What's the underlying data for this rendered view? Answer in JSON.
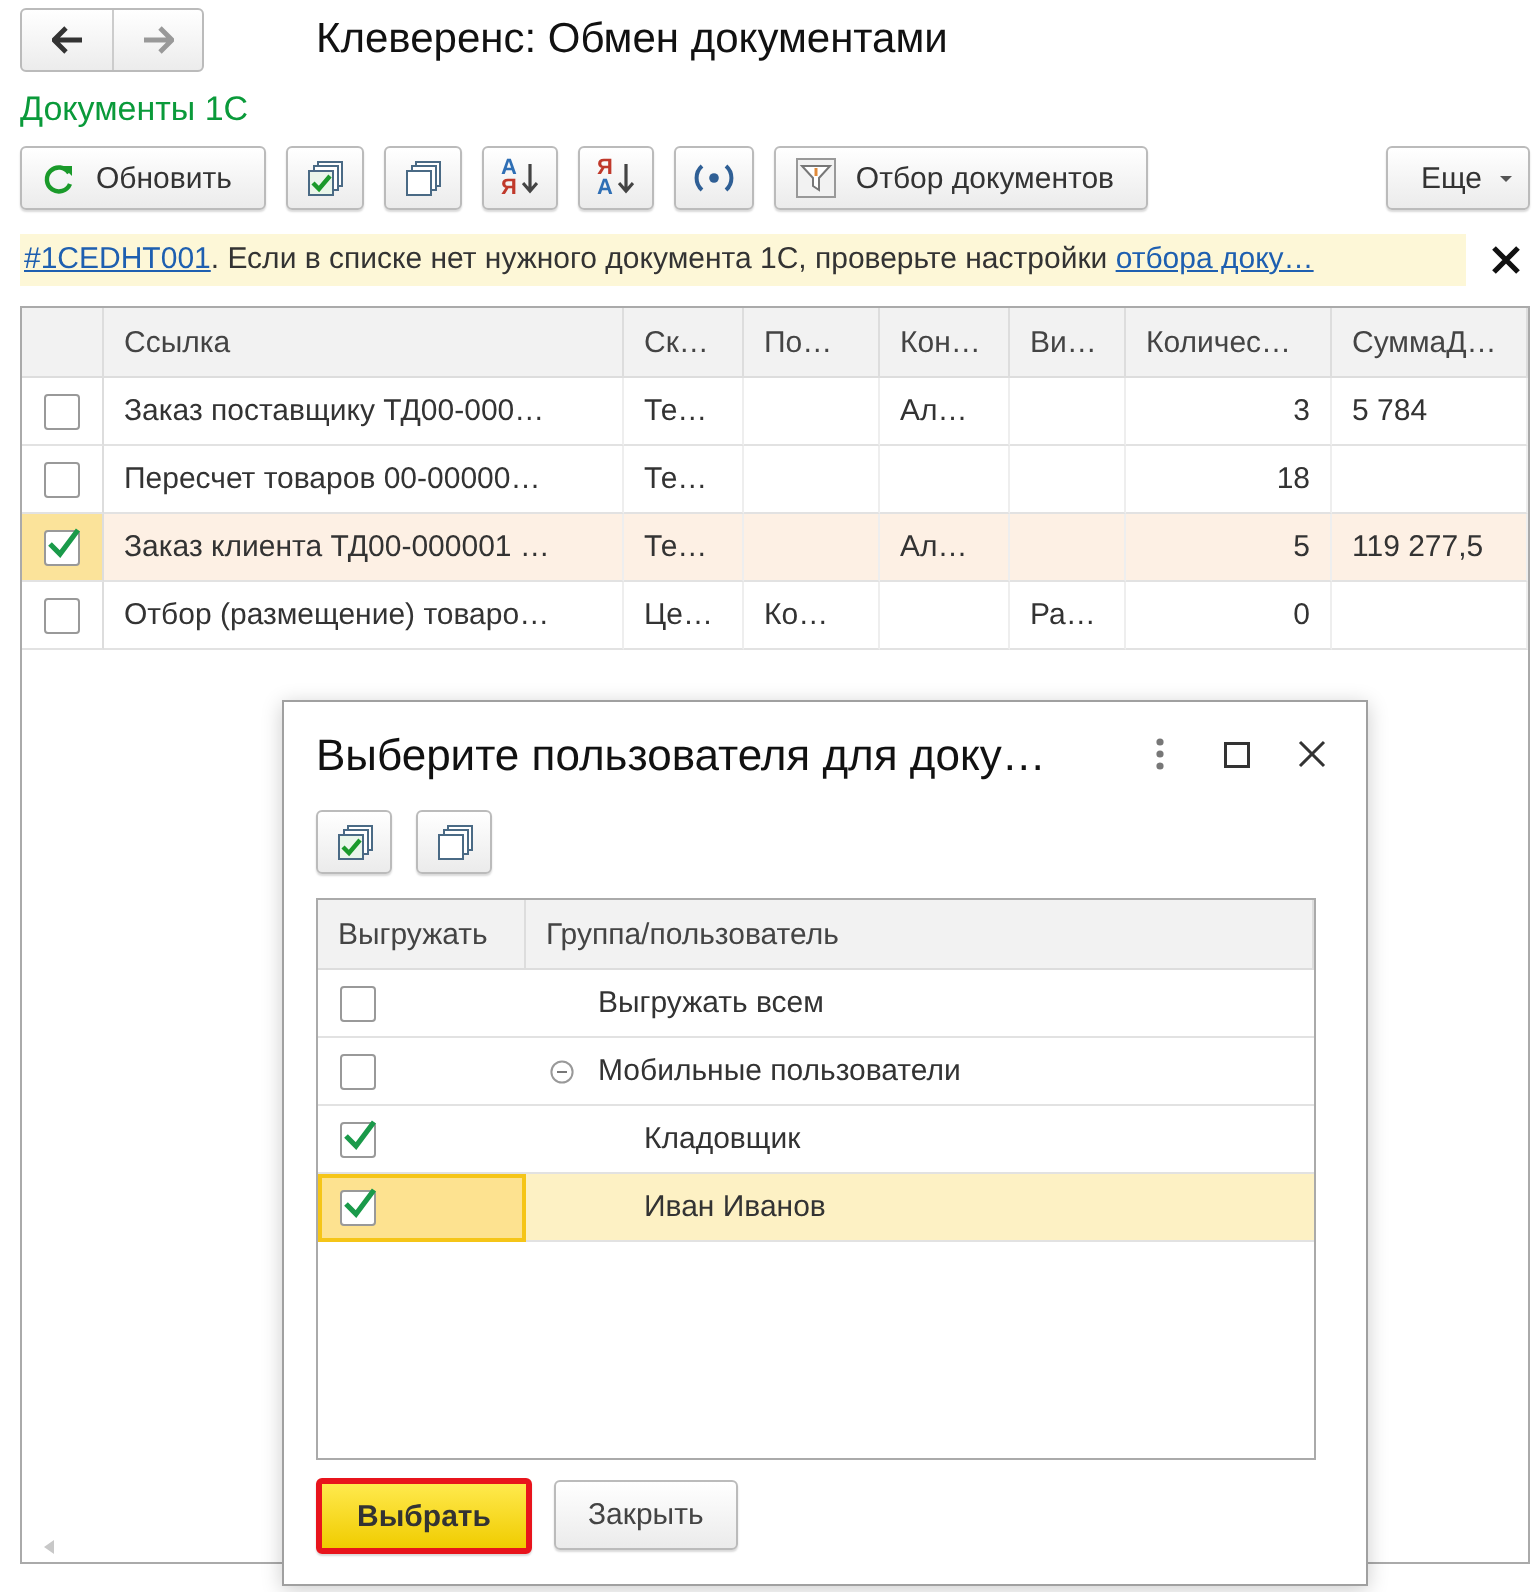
{
  "window": {
    "title": "Клеверенс: Обмен документами"
  },
  "section_title": "Документы 1С",
  "toolbar": [
    {
      "kind": "refresh",
      "label": "Обновить"
    },
    {
      "kind": "check_all"
    },
    {
      "kind": "uncheck_all"
    },
    {
      "kind": "sort_asc",
      "top": "А",
      "bottom": "Я"
    },
    {
      "kind": "sort_desc",
      "top": "Я",
      "bottom": "А"
    },
    {
      "kind": "signal"
    },
    {
      "kind": "filter",
      "label": "Отбор документов"
    },
    {
      "kind": "more",
      "label": "Еще"
    }
  ],
  "info": {
    "code_link": "#1CEDHT001",
    "text": ". Если в списке нет нужного документа 1С, проверьте настройки ",
    "settings_link": "отбора доку…"
  },
  "table": {
    "columns": [
      "Ссылка",
      "Ск…",
      "По…",
      "Кон…",
      "Ви…",
      "Количес…",
      "СуммаД…"
    ],
    "rows": [
      {
        "checked": false,
        "selected": false,
        "cells": [
          "Заказ поставщику ТД00-000…",
          "Те…",
          null,
          "Ал…",
          null,
          "3",
          "5 784"
        ]
      },
      {
        "checked": false,
        "selected": false,
        "cells": [
          "Пересчет товаров 00-00000…",
          "Те…",
          null,
          null,
          null,
          "18",
          null
        ]
      },
      {
        "checked": true,
        "selected": true,
        "cells": [
          "Заказ клиента ТД00-000001 …",
          "Те…",
          null,
          "Ал…",
          null,
          "5",
          "119 277,5"
        ]
      },
      {
        "checked": false,
        "selected": false,
        "cells": [
          "Отбор (размещение) товаро…",
          "Це…",
          "Ко…",
          null,
          "Ра…",
          "0",
          null
        ]
      }
    ]
  },
  "dialog": {
    "title": "Выберите пользователя для доку…",
    "toolbar": [
      {
        "kind": "check_all"
      },
      {
        "kind": "uncheck_all"
      }
    ],
    "columns": [
      "Выгружать",
      "Группа/пользователь"
    ],
    "rows": [
      {
        "name": "Выгружать всем",
        "checked": false,
        "selected": false
      },
      {
        "name": "Мобильные пользователи",
        "checked": false,
        "selected": false,
        "expanded": true,
        "children": [
          {
            "name": "Кладовщик",
            "checked": true,
            "selected": false
          },
          {
            "name": "Иван Иванов",
            "checked": true,
            "selected": true
          }
        ]
      }
    ],
    "buttons": [
      {
        "label": "Выбрать",
        "default": true
      },
      {
        "label": "Закрыть",
        "default": false
      }
    ]
  }
}
